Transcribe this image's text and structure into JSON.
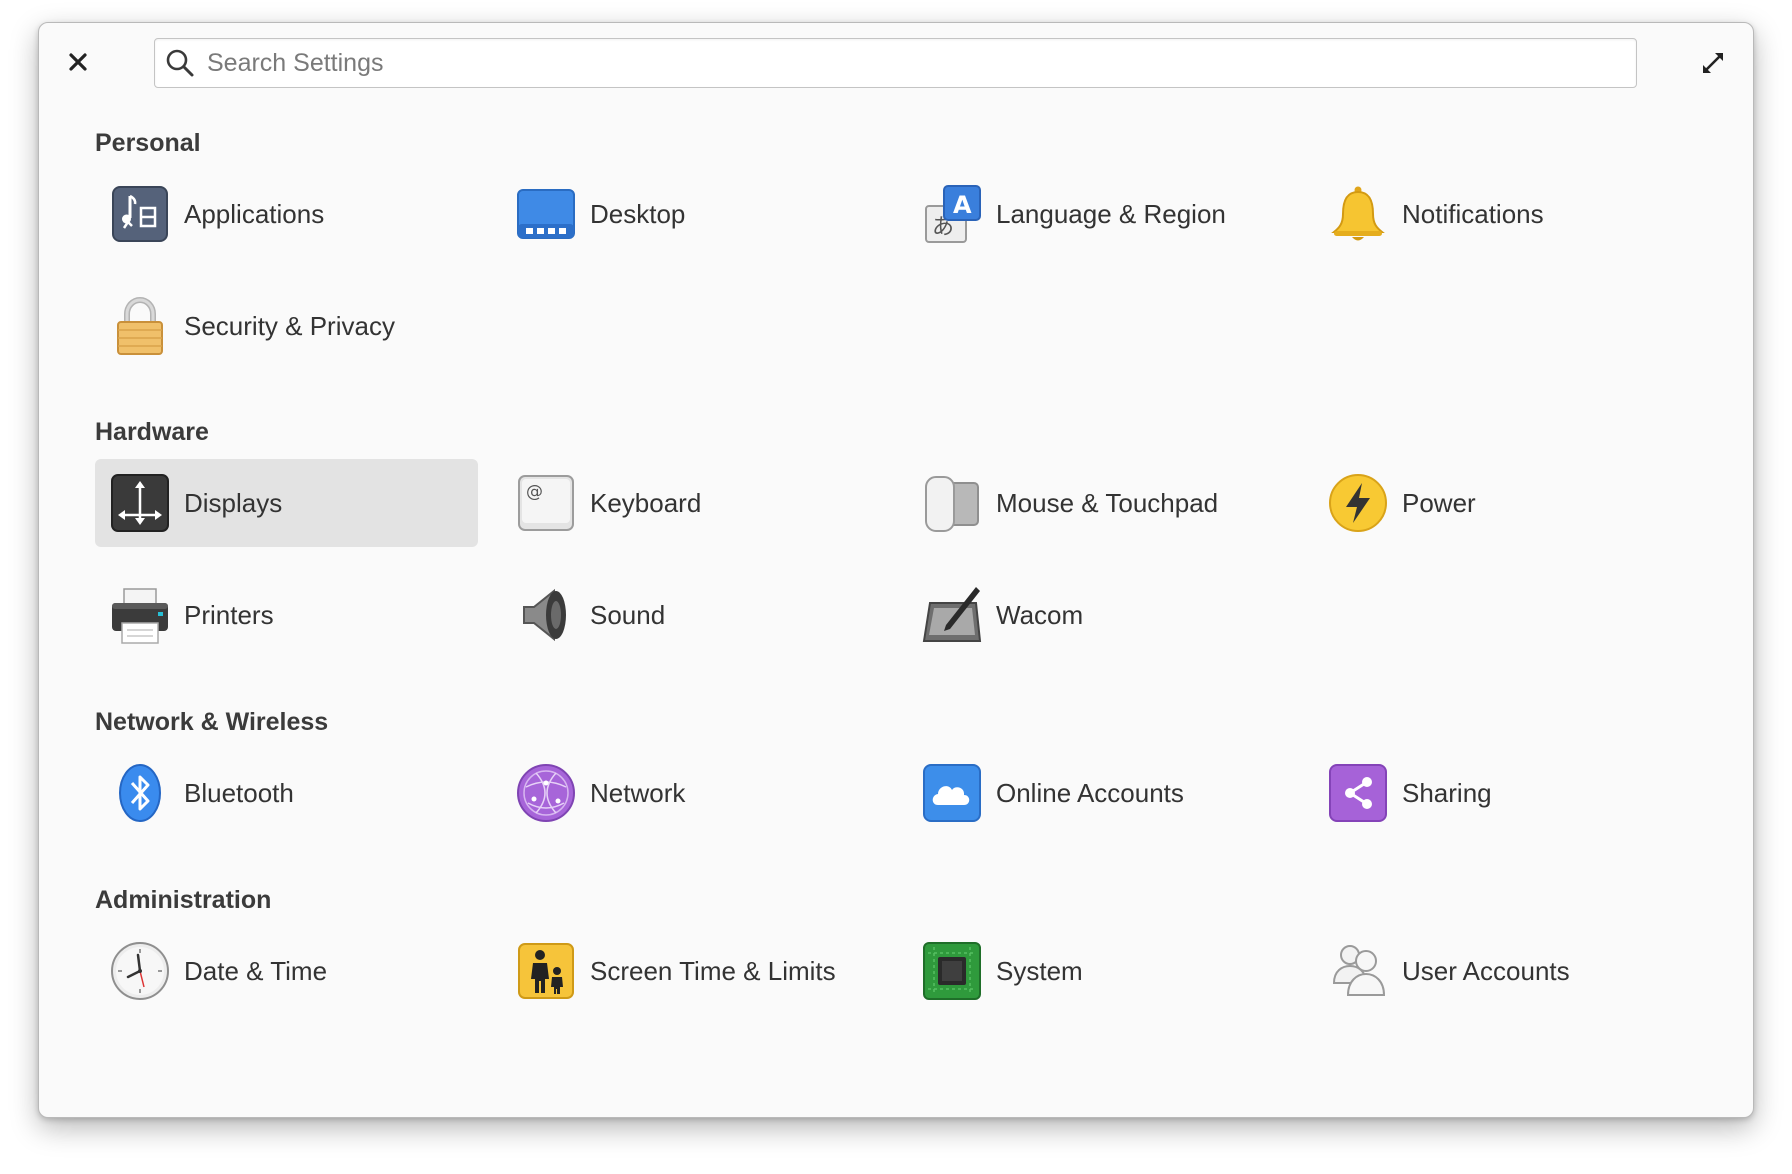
{
  "window": {
    "close_icon": "close-icon",
    "maximize_icon": "maximize-icon"
  },
  "search": {
    "placeholder": "Search Settings",
    "value": ""
  },
  "categories": [
    {
      "title": "Personal",
      "items": [
        {
          "label": "Applications",
          "icon": "applications-icon"
        },
        {
          "label": "Desktop",
          "icon": "desktop-icon"
        },
        {
          "label": "Language & Region",
          "icon": "language-icon"
        },
        {
          "label": "Notifications",
          "icon": "bell-icon"
        },
        {
          "label": "Security & Privacy",
          "icon": "lock-icon"
        }
      ]
    },
    {
      "title": "Hardware",
      "items": [
        {
          "label": "Displays",
          "icon": "display-icon",
          "selected": true
        },
        {
          "label": "Keyboard",
          "icon": "keyboard-icon"
        },
        {
          "label": "Mouse & Touchpad",
          "icon": "mouse-icon"
        },
        {
          "label": "Power",
          "icon": "power-icon"
        },
        {
          "label": "Printers",
          "icon": "printer-icon"
        },
        {
          "label": "Sound",
          "icon": "speaker-icon"
        },
        {
          "label": "Wacom",
          "icon": "tablet-icon"
        }
      ]
    },
    {
      "title": "Network & Wireless",
      "items": [
        {
          "label": "Bluetooth",
          "icon": "bluetooth-icon"
        },
        {
          "label": "Network",
          "icon": "network-icon"
        },
        {
          "label": "Online Accounts",
          "icon": "cloud-icon"
        },
        {
          "label": "Sharing",
          "icon": "share-icon"
        }
      ]
    },
    {
      "title": "Administration",
      "items": [
        {
          "label": "Date & Time",
          "icon": "clock-icon"
        },
        {
          "label": "Screen Time & Limits",
          "icon": "parental-controls-icon"
        },
        {
          "label": "System",
          "icon": "chip-icon"
        },
        {
          "label": "User Accounts",
          "icon": "users-icon"
        }
      ]
    }
  ]
}
